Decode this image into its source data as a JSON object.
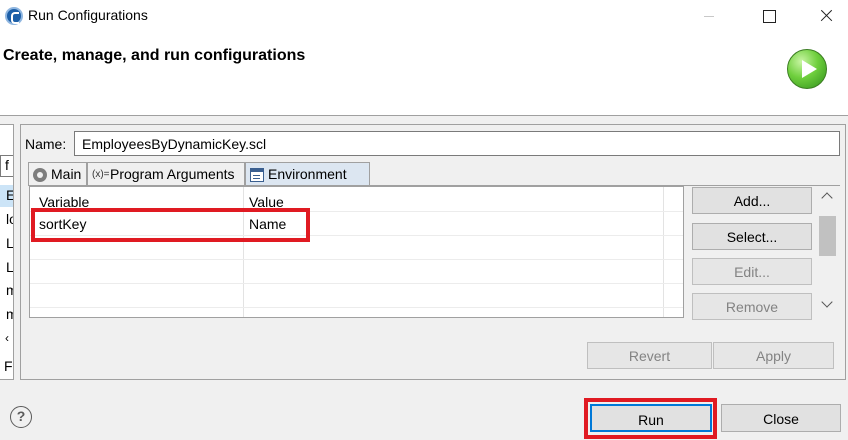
{
  "window": {
    "title": "Run Configurations"
  },
  "header": {
    "title": "Create, manage, and run configurations"
  },
  "left_panel": {
    "items": [
      "E",
      "lo",
      "L",
      "L",
      "m",
      "m",
      "Fi"
    ],
    "filter_value": "f",
    "collapse_arrow": "‹"
  },
  "config": {
    "name_label": "Name:",
    "name_value": "EmployeesByDynamicKey.scl"
  },
  "tabs": [
    {
      "label": "Main",
      "icon": "main-icon"
    },
    {
      "label": "Program Arguments",
      "icon": "arguments-icon",
      "icon_glyph": "(x)="
    },
    {
      "label": "Environment",
      "icon": "environment-icon",
      "active": true
    }
  ],
  "env_table": {
    "columns": [
      "Variable",
      "Value"
    ],
    "rows": [
      {
        "variable": "sortKey",
        "value": "Name"
      }
    ]
  },
  "env_buttons": {
    "add": "Add...",
    "select": "Select...",
    "edit": "Edit...",
    "remove": "Remove"
  },
  "footer_buttons": {
    "revert": "Revert",
    "apply": "Apply"
  },
  "dialog_buttons": {
    "run": "Run",
    "close": "Close"
  },
  "help": {
    "glyph": "?"
  },
  "colors": {
    "highlight": "#e01a22",
    "active_tab": "#dce6f1",
    "default_button_border": "#0078d7"
  }
}
